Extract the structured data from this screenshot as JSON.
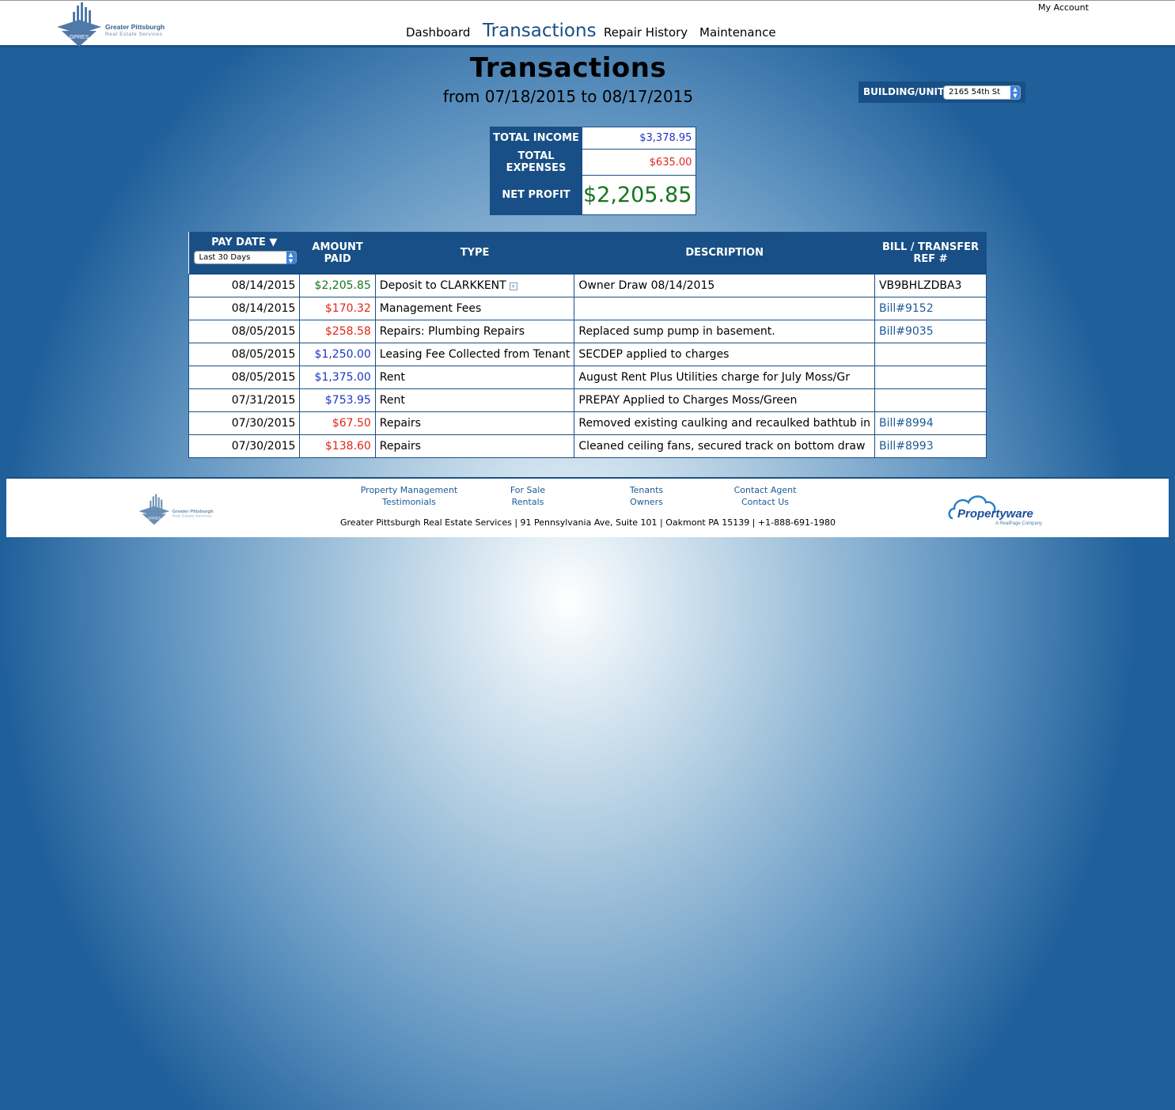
{
  "brand": {
    "name_line1": "Greater Pittsburgh",
    "name_line2": "Real Estate Services",
    "badge": "GPRES"
  },
  "header": {
    "my_account": "My Account",
    "nav": [
      {
        "label": "Dashboard",
        "active": false
      },
      {
        "label": "Transactions",
        "active": true
      },
      {
        "label": "Repair History",
        "active": false
      },
      {
        "label": "Maintenance",
        "active": false
      }
    ]
  },
  "page": {
    "title": "Transactions",
    "subtitle": "from 07/18/2015 to 08/17/2015"
  },
  "unit_filter": {
    "label": "BUILDING/UNIT:",
    "selected": "2165 54th St"
  },
  "summary": {
    "total_income_label": "TOTAL INCOME",
    "total_income": "$3,378.95",
    "total_expenses_label": "TOTAL EXPENSES",
    "total_expenses": "$635.00",
    "net_profit_label": "NET PROFIT",
    "net_profit": "$2,205.85"
  },
  "table": {
    "columns": {
      "pay_date": "PAY DATE",
      "amount": "AMOUNT PAID",
      "type": "TYPE",
      "description": "DESCRIPTION",
      "ref": "BILL / TRANSFER REF #"
    },
    "date_range_selected": "Last 30 Days",
    "rows": [
      {
        "date": "08/14/2015",
        "amount": "$2,205.85",
        "amount_color": "green",
        "type": "Deposit to CLARKKENT",
        "description": "Owner Draw 08/14/2015",
        "ref": "VB9BHLZDBA3",
        "ref_is_link": false
      },
      {
        "date": "08/14/2015",
        "amount": "$170.32",
        "amount_color": "red",
        "type": "Management Fees",
        "description": "",
        "ref": "Bill#9152",
        "ref_is_link": true
      },
      {
        "date": "08/05/2015",
        "amount": "$258.58",
        "amount_color": "red",
        "type": "Repairs: Plumbing Repairs",
        "description": "Replaced sump pump in basement.",
        "ref": "Bill#9035",
        "ref_is_link": true
      },
      {
        "date": "08/05/2015",
        "amount": "$1,250.00",
        "amount_color": "blue",
        "type": "Leasing Fee Collected from Tenant",
        "description": "SECDEP applied to charges",
        "ref": "",
        "ref_is_link": false
      },
      {
        "date": "08/05/2015",
        "amount": "$1,375.00",
        "amount_color": "blue",
        "type": "Rent",
        "description": "August Rent Plus Utilities charge for July Moss/Gr",
        "ref": "",
        "ref_is_link": false
      },
      {
        "date": "07/31/2015",
        "amount": "$753.95",
        "amount_color": "blue",
        "type": "Rent",
        "description": "PREPAY Applied to Charges Moss/Green",
        "ref": "",
        "ref_is_link": false
      },
      {
        "date": "07/30/2015",
        "amount": "$67.50",
        "amount_color": "red",
        "type": "Repairs",
        "description": "Removed existing caulking and recaulked bathtub in",
        "ref": "Bill#8994",
        "ref_is_link": true
      },
      {
        "date": "07/30/2015",
        "amount": "$138.60",
        "amount_color": "red",
        "type": "Repairs",
        "description": "Cleaned ceiling fans, secured track on bottom draw",
        "ref": "Bill#8993",
        "ref_is_link": true
      }
    ]
  },
  "footer": {
    "links": {
      "property_management": "Property Management",
      "testimonials": "Testimonials",
      "for_sale": "For Sale",
      "rentals": "Rentals",
      "tenants": "Tenants",
      "owners": "Owners",
      "contact_agent": "Contact Agent",
      "contact_us": "Contact Us"
    },
    "address": "Greater Pittsburgh Real Estate Services | 91 Pennsylvania Ave, Suite 101 | Oakmont PA 15139 | +1-888-691-1980",
    "partner_name": "Propertyware",
    "partner_tagline": "A RealPage Company"
  },
  "colors": {
    "primary": "#184f86",
    "income": "#1a36c9",
    "expense": "#e0261a",
    "profit": "#16751e",
    "link": "#1d5a96"
  }
}
